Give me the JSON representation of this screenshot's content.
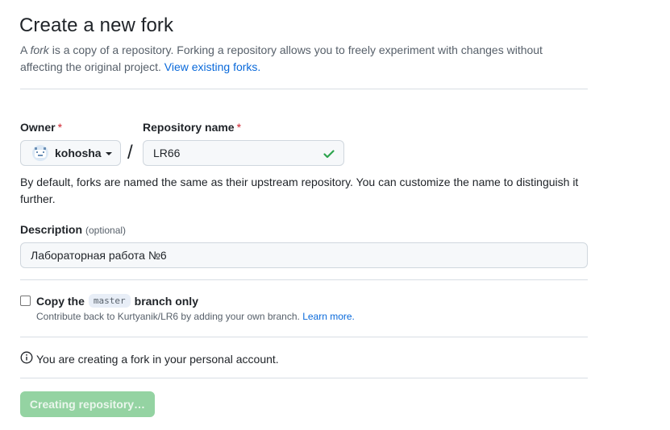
{
  "header": {
    "title": "Create a new fork",
    "subtitle_prefix": "A ",
    "subtitle_fork": "fork",
    "subtitle_rest": " is a copy of a repository. Forking a repository allows you to freely experiment with changes without affecting the original project. ",
    "view_forks_link": "View existing forks."
  },
  "owner": {
    "label": "Owner",
    "required_mark": "*",
    "value": "kohosha"
  },
  "repository": {
    "label": "Repository name",
    "required_mark": "*",
    "value": "LR66",
    "separator": "/"
  },
  "naming_hint": "By default, forks are named the same as their upstream repository. You can customize the name to distinguish it further.",
  "description": {
    "label": "Description",
    "optional_label": "(optional)",
    "value": "Лабораторная работа №6"
  },
  "copy_branch": {
    "label_prefix": "Copy the",
    "branch": "master",
    "label_suffix": "branch only",
    "checked": false,
    "note_prefix": "Contribute back to Kurtyanik/LR6 by adding your own branch. ",
    "learn_more": "Learn more."
  },
  "info_message": "You are creating a fork in your personal account.",
  "submit_button": "Creating repository…",
  "colors": {
    "link": "#0969da",
    "required": "#cf222e",
    "success": "#2da44e",
    "button_disabled": "#94d3a2"
  },
  "icons": {
    "avatar": "avatar-icon",
    "caret": "caret-down-icon",
    "check": "check-icon",
    "info": "info-icon"
  }
}
